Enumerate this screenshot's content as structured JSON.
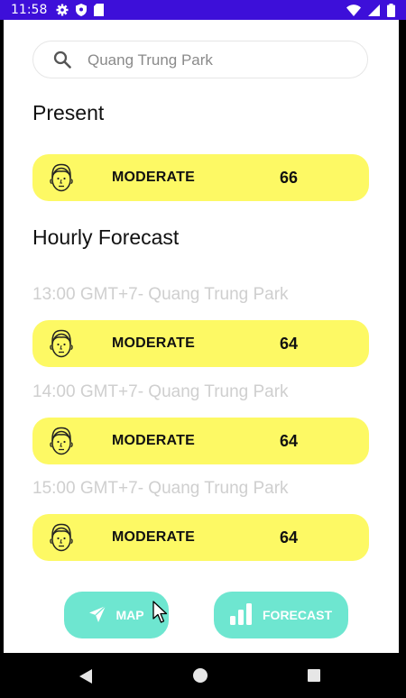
{
  "status_bar": {
    "time": "11:58"
  },
  "search": {
    "value": "Quang Trung Park"
  },
  "present": {
    "title": "Present",
    "level": "MODERATE",
    "value": "66"
  },
  "forecast": {
    "title": "Hourly Forecast",
    "items": [
      {
        "time_label": "13:00 GMT+7- Quang Trung Park",
        "level": "MODERATE",
        "value": "64"
      },
      {
        "time_label": "14:00 GMT+7- Quang Trung Park",
        "level": "MODERATE",
        "value": "64"
      },
      {
        "time_label": "15:00 GMT+7- Quang Trung Park",
        "level": "MODERATE",
        "value": "64"
      }
    ]
  },
  "bottom_nav": {
    "map_label": "MAP",
    "forecast_label": "FORECAST"
  },
  "colors": {
    "status_bar": "#3d0fd9",
    "aqi_moderate": "#fdf964",
    "nav_button": "#6ee6d0"
  },
  "icons": [
    "settings-icon",
    "shield-icon",
    "sd-card-icon",
    "wifi-icon",
    "signal-icon",
    "battery-icon",
    "search-icon",
    "face-icon",
    "navigation-icon",
    "bar-chart-icon"
  ]
}
